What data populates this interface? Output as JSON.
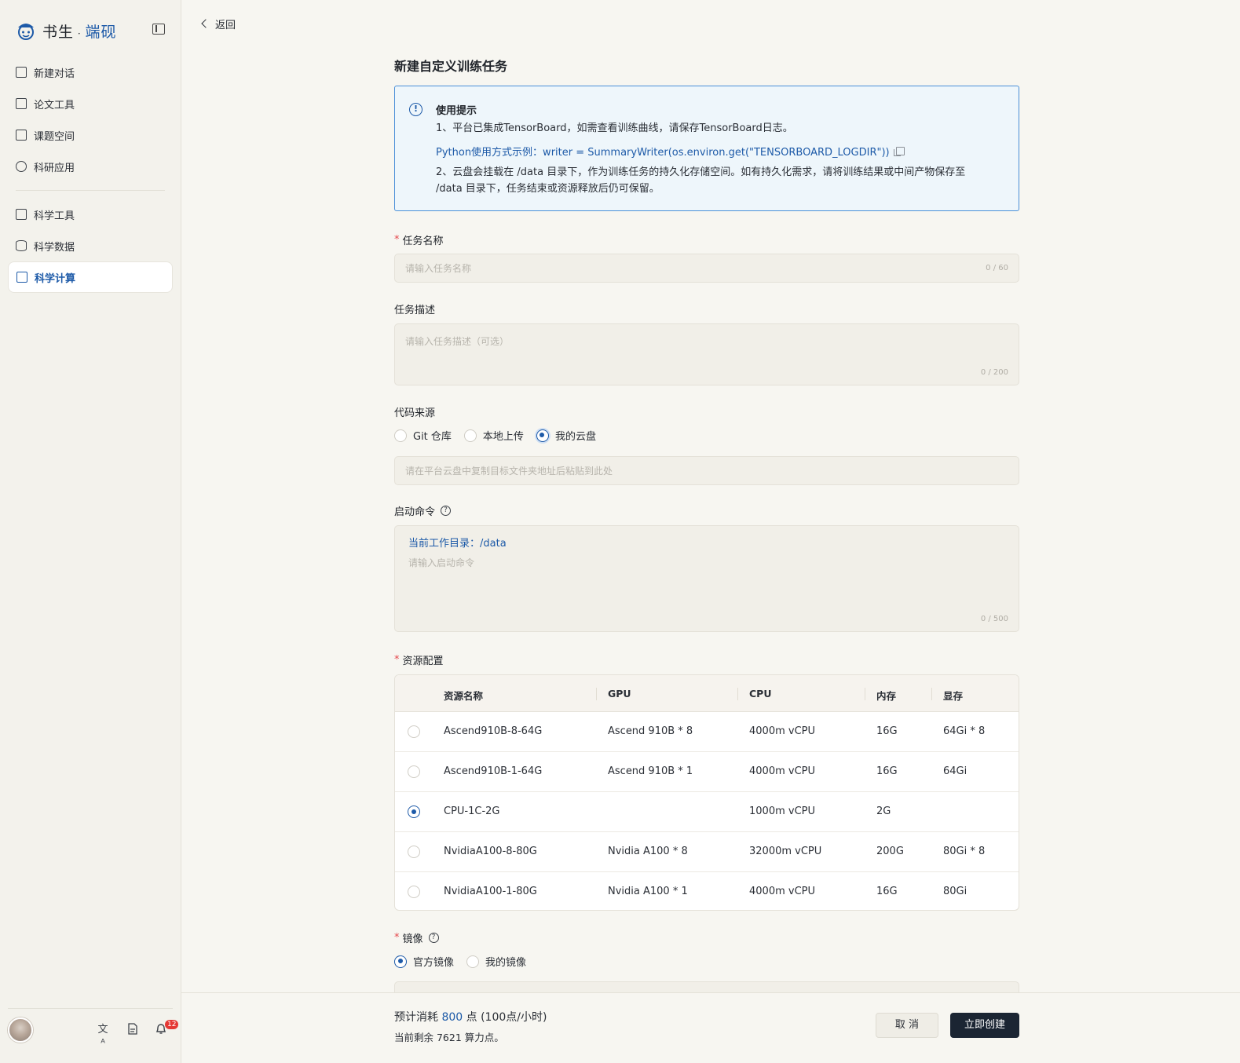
{
  "sidebar": {
    "logo_main": "书生",
    "logo_dot": " · ",
    "logo_accent": "端砚",
    "items": [
      {
        "label": "新建对话",
        "icon": "plus-square-icon"
      },
      {
        "label": "论文工具",
        "icon": "document-icon"
      },
      {
        "label": "课题空间",
        "icon": "library-icon"
      },
      {
        "label": "科研应用",
        "icon": "cube-icon"
      },
      {
        "label": "科学工具",
        "icon": "toolbox-icon"
      },
      {
        "label": "科学数据",
        "icon": "database-icon"
      },
      {
        "label": "科学计算",
        "icon": "monitor-chart-icon",
        "active": true
      }
    ],
    "bottom": {
      "translate_icon": "文ᴬ",
      "notification_count": "12"
    }
  },
  "header": {
    "back_label": "返回",
    "title": "新建自定义训练任务"
  },
  "tip": {
    "title": "使用提示",
    "line1": "1、平台已集成TensorBoard，如需查看训练曲线，请保存TensorBoard日志。",
    "code": "Python使用方式示例：writer = SummaryWriter(os.environ.get(\"TENSORBOARD_LOGDIR\"))",
    "line2a": "2、云盘会挂载在 /data 目录下，作为训练任务的持久化存储空间。如有持久化需求，请将训练结果或中间产物保存至",
    "line2b": "/data 目录下，任务结束或资源释放后仍可保留。"
  },
  "form": {
    "task_name": {
      "label": "任务名称",
      "placeholder": "请输入任务名称",
      "count": "0 / 60"
    },
    "task_desc": {
      "label": "任务描述",
      "placeholder": "请输入任务描述（可选）",
      "count": "0 / 200"
    },
    "code_source": {
      "label": "代码来源",
      "options": [
        "Git 仓库",
        "本地上传",
        "我的云盘"
      ],
      "selected": "我的云盘",
      "path_placeholder": "请在平台云盘中复制目标文件夹地址后粘贴到此处"
    },
    "start_cmd": {
      "label": "启动命令",
      "workdir": "当前工作目录：/data",
      "placeholder": "请输入启动命令",
      "count": "0 / 500"
    },
    "resource": {
      "label": "资源配置",
      "columns": [
        "资源名称",
        "GPU",
        "CPU",
        "内存",
        "显存"
      ],
      "rows": [
        {
          "name": "Ascend910B-8-64G",
          "gpu": "Ascend 910B * 8",
          "cpu": "4000m vCPU",
          "mem": "16G",
          "vram": "64Gi * 8",
          "selected": false
        },
        {
          "name": "Ascend910B-1-64G",
          "gpu": "Ascend 910B * 1",
          "cpu": "4000m vCPU",
          "mem": "16G",
          "vram": "64Gi",
          "selected": false
        },
        {
          "name": "CPU-1C-2G",
          "gpu": "",
          "cpu": "1000m vCPU",
          "mem": "2G",
          "vram": "",
          "selected": true
        },
        {
          "name": "NvidiaA100-8-80G",
          "gpu": "Nvidia A100 * 8",
          "cpu": "32000m vCPU",
          "mem": "200G",
          "vram": "80Gi * 8",
          "selected": false
        },
        {
          "name": "NvidiaA100-1-80G",
          "gpu": "Nvidia A100 * 1",
          "cpu": "4000m vCPU",
          "mem": "16G",
          "vram": "80Gi",
          "selected": false
        }
      ]
    },
    "image": {
      "label": "镜像",
      "options": [
        "官方镜像",
        "我的镜像"
      ],
      "selected": "官方镜像"
    }
  },
  "footer": {
    "cost_prefix": "预计消耗 ",
    "cost_value": "800",
    "cost_suffix": " 点 (100点/小时)",
    "remain": "当前剩余 7621 算力点。",
    "cancel_label": "取 消",
    "create_label": "立即创建"
  },
  "colors": {
    "accent": "#1d5aa8",
    "primary_button": "#1b2533",
    "required": "#e5484d",
    "tip_border": "#4a8fd8"
  }
}
